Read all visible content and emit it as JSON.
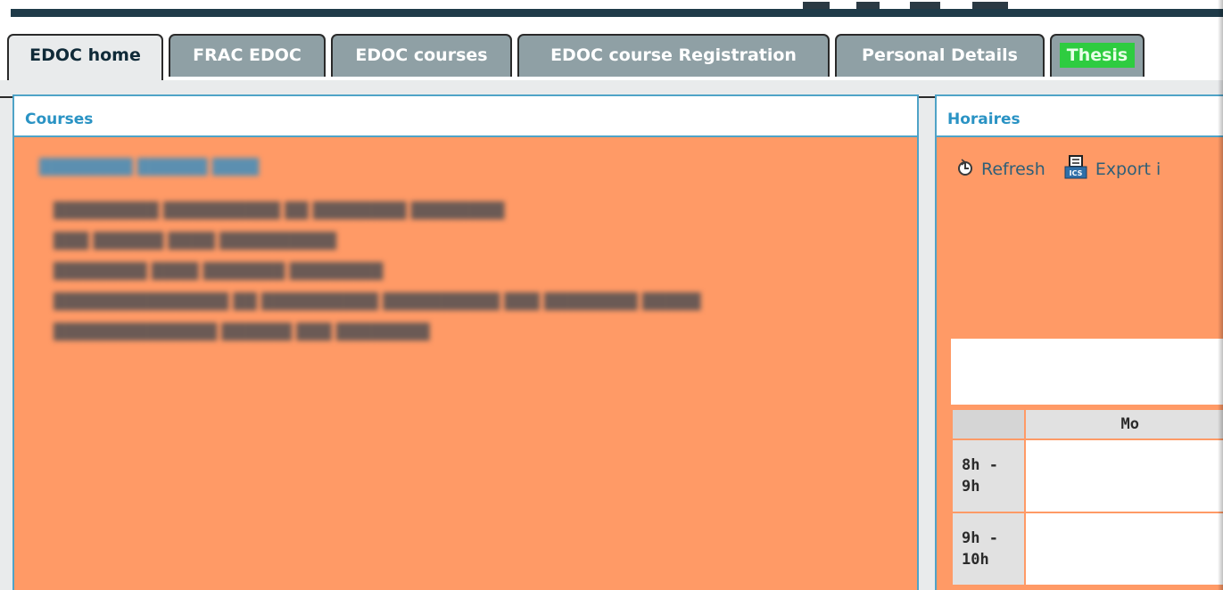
{
  "tabs": [
    {
      "label": "EDOC home",
      "active": true
    },
    {
      "label": "FRAC EDOC",
      "active": false
    },
    {
      "label": "EDOC courses",
      "active": false
    },
    {
      "label": "EDOC course Registration",
      "active": false
    },
    {
      "label": "Personal Details",
      "active": false
    },
    {
      "label": "Thesis",
      "active": false,
      "highlight": "#2ecc40"
    }
  ],
  "courses": {
    "title": "Courses"
  },
  "schedule": {
    "title": "Horaires",
    "refresh_label": "Refresh",
    "refresh_icon": "refresh-icon",
    "export_label": "Export i",
    "export_icon": "ics-file-icon",
    "table": {
      "days": [
        "Mo"
      ],
      "rows": [
        {
          "hour_start": "8h -",
          "hour_end": "9h"
        },
        {
          "hour_start": "9h -",
          "hour_end": "10h"
        }
      ]
    }
  },
  "colors": {
    "panel_bg": "#ff9a66",
    "panel_border": "#4fa3c7",
    "title_color": "#2a93c4",
    "tab_bg": "#8fa0a5",
    "tab_active_bg": "#e9ebec",
    "thesis_highlight": "#2ecc40"
  }
}
